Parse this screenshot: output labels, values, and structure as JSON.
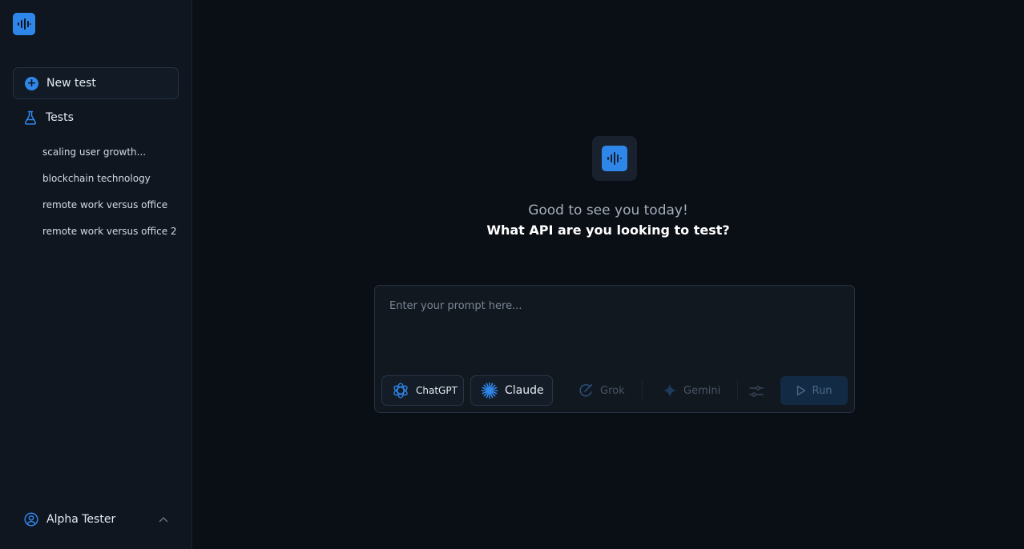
{
  "sidebar": {
    "new_test_label": "New test",
    "tests_label": "Tests",
    "tests": [
      "scaling user growth...",
      "blockchain technology",
      "remote work versus office",
      "remote work versus office 2"
    ],
    "user_name": "Alpha Tester"
  },
  "main": {
    "greeting": "Good to see you today!",
    "question": "What API are you looking to test?",
    "prompt_placeholder": "Enter your prompt here...",
    "models": {
      "chatgpt": "ChatGPT",
      "claude": "Claude",
      "grok": "Grok",
      "gemini": "Gemini"
    },
    "run_label": "Run"
  },
  "colors": {
    "accent": "#2f86e9",
    "background": "#0a0e15",
    "sidebar": "#0f1620"
  },
  "icons": {
    "logo": "waveform-icon",
    "new_test": "plus-circle-icon",
    "tests": "flask-icon",
    "user": "user-circle-icon",
    "chevron": "chevron-up-icon",
    "chatgpt": "openai-icon",
    "claude": "claude-starburst-icon",
    "grok": "grok-icon",
    "gemini": "gemini-sparkle-icon",
    "settings": "sliders-icon",
    "run": "play-icon"
  }
}
